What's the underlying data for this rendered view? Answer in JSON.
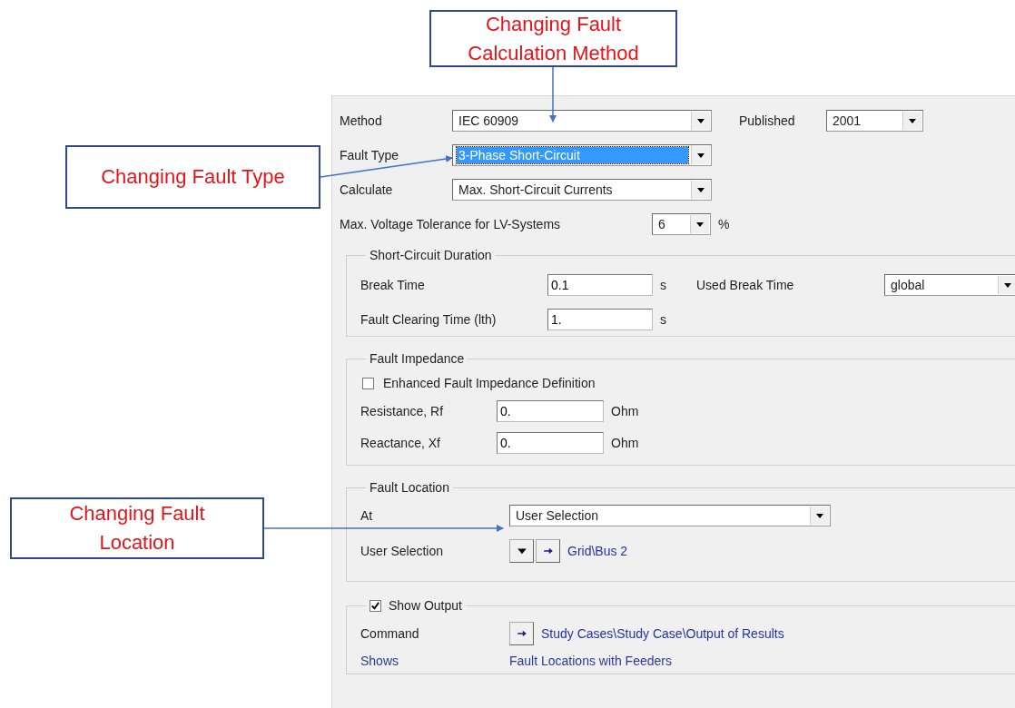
{
  "annotations": [
    {
      "text": "Changing Fault Calculation Method"
    },
    {
      "text": "Changing Fault Type"
    },
    {
      "text": "Changing Fault Location"
    }
  ],
  "top_rows": [
    {
      "label": "Method",
      "value": "IEC 60909",
      "selected": false
    },
    {
      "label": "Fault Type",
      "value": "3-Phase Short-Circuit",
      "selected": true
    },
    {
      "label": "Calculate",
      "value": "Max. Short-Circuit Currents",
      "selected": false
    }
  ],
  "published": {
    "label": "Published",
    "value": "2001"
  },
  "voltage_tolerance": {
    "label": "Max. Voltage Tolerance for LV-Systems",
    "value": "6",
    "unit": "%"
  },
  "short_circuit_duration": {
    "title": "Short-Circuit Duration",
    "break_time": {
      "label": "Break Time",
      "value": "0.1",
      "unit": "s"
    },
    "used_break_time": {
      "label": "Used Break Time",
      "value": "global"
    },
    "fault_clearing_time": {
      "label": "Fault Clearing Time (lth)",
      "value": "1.",
      "unit": "s"
    }
  },
  "fault_impedance": {
    "title": "Fault Impedance",
    "enhanced": {
      "label": "Enhanced Fault Impedance Definition",
      "checked": false
    },
    "fields": [
      {
        "label": "Resistance, Rf",
        "value": "0.",
        "unit": "Ohm"
      },
      {
        "label": "Reactance, Xf",
        "value": "0.",
        "unit": "Ohm"
      }
    ]
  },
  "fault_location": {
    "title": "Fault Location",
    "at": {
      "label": "At",
      "value": "User Selection"
    },
    "user_selection": {
      "label": "User Selection",
      "value": "Grid\\Bus 2"
    }
  },
  "show_output": {
    "title": "Show Output",
    "checked": true,
    "command": {
      "label": "Command",
      "value": "Study Cases\\Study Case\\Output of Results"
    },
    "shows": {
      "label": "Shows",
      "value": "Fault Locations with Feeders"
    }
  }
}
